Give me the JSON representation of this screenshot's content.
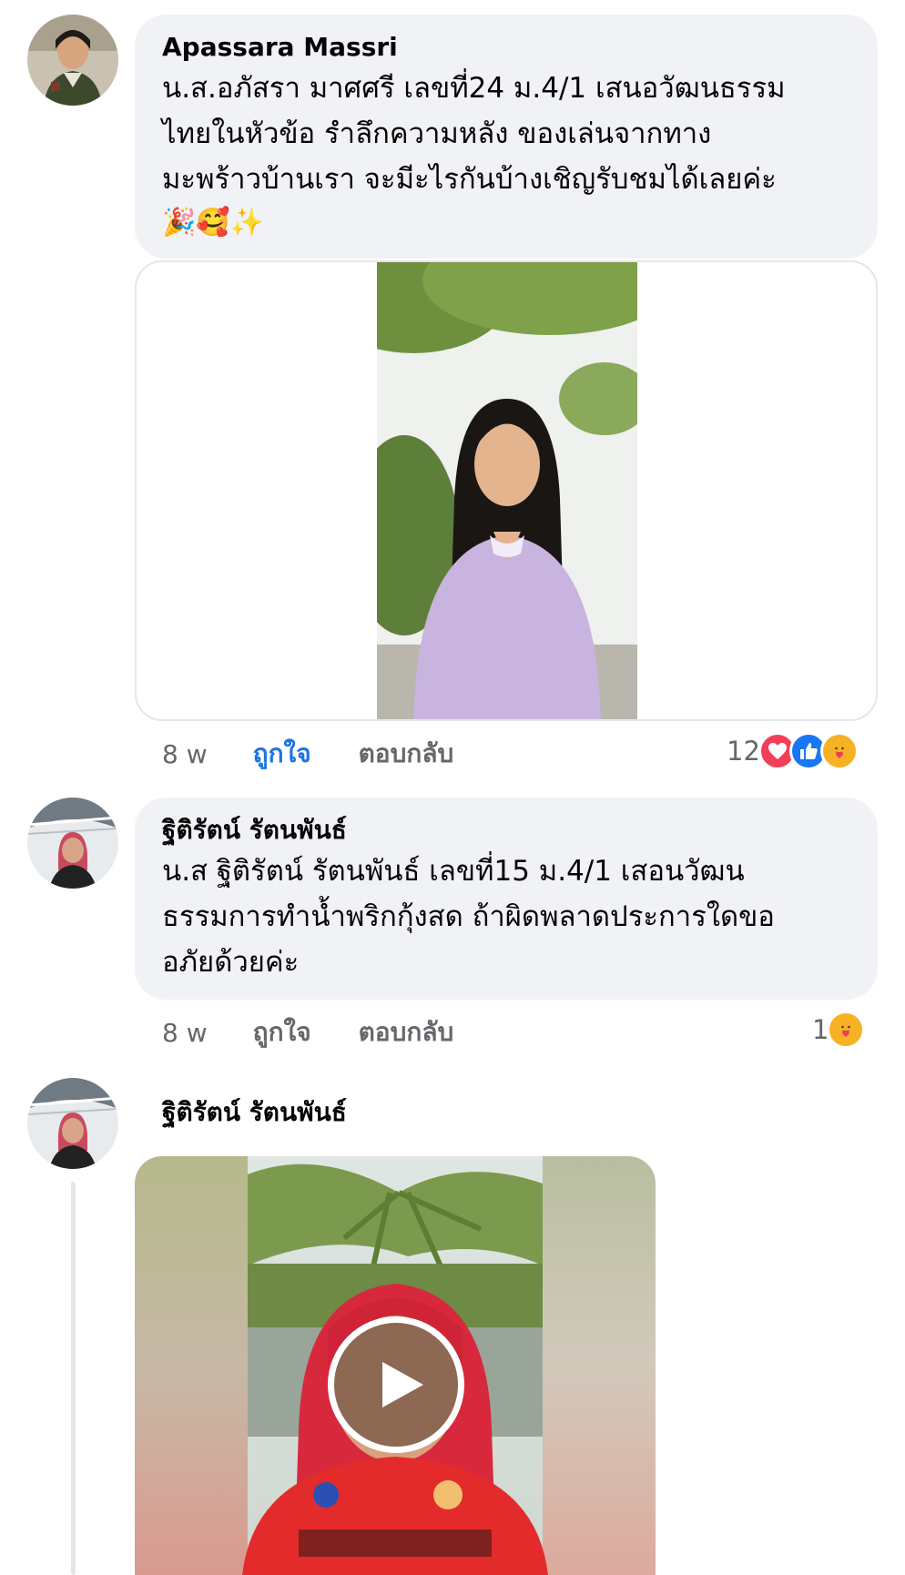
{
  "comments": [
    {
      "author": "Apassara Massri",
      "text": "น.ส.อภัสรา มาศศรี เลขที่24 ม.4/1 เสนอวัฒนธรรม\nไทยในหัวข้อ รำลึกความหลัง ของเล่นจากทาง\nมะพร้าวบ้านเรา  จะมีะไรกันบ้างเชิญรับชมได้เลยค่ะ",
      "emojis": "🎉🥰✨",
      "time": "8 w",
      "like_label": "ถูกใจ",
      "reply_label": "ตอบกลับ",
      "reaction_count": "12",
      "reactions": [
        "love-icon",
        "like-icon",
        "care-icon"
      ]
    },
    {
      "author": "ฐิติรัตน์ รัตนพันธ์",
      "text": "น.ส ฐิติรัตน์  รัตนพันธ์  เลขที่15  ม.4/1  เสอนวัฒน\nธรรมการทำน้ำพริกกุ้งสด   ถ้าผิดพลาดประการใดขอ\nอภัยด้วยค่ะ",
      "time": "8 w",
      "like_label": "ถูกใจ",
      "reply_label": "ตอบกลับ",
      "reaction_count": "1",
      "reactions": [
        "care-icon"
      ]
    },
    {
      "author": "ฐิติรัตน์ รัตนพันธ์"
    }
  ],
  "colors": {
    "bubble": "#f0f2f5",
    "like_active": "#1b74e4",
    "meta_text": "#65676b",
    "love": "#f33e58",
    "like": "#1877f2",
    "care": "#f7b125"
  }
}
